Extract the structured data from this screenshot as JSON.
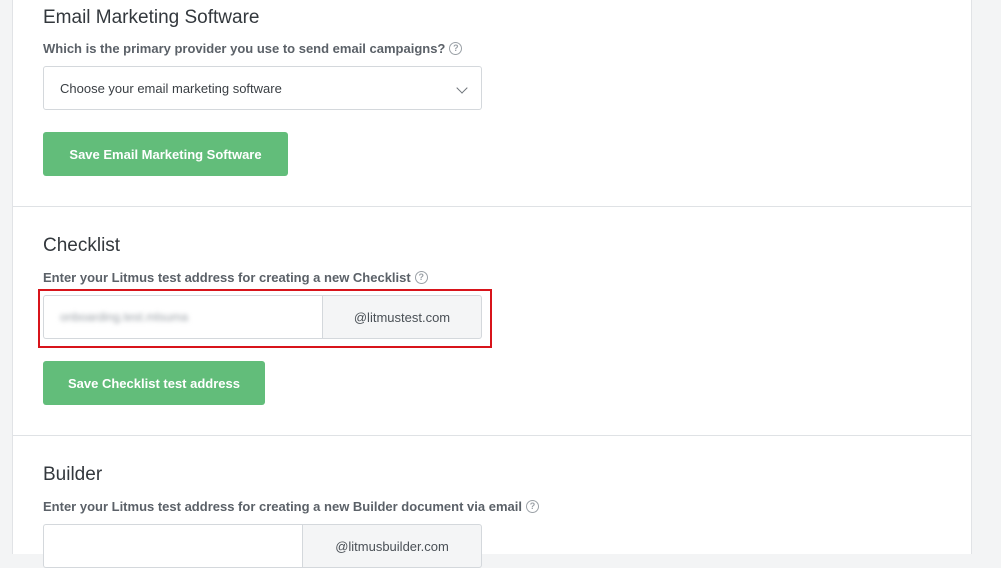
{
  "email_marketing": {
    "title": "Email Marketing Software",
    "question": "Which is the primary provider you use to send email campaigns?",
    "select_value": "Choose your email marketing software",
    "save_label": "Save Email Marketing Software"
  },
  "checklist": {
    "title": "Checklist",
    "question": "Enter your Litmus test address for creating a new Checklist",
    "address_value": "onboarding.test.mlsuma",
    "domain_suffix": "@litmustest.com",
    "save_label": "Save Checklist test address"
  },
  "builder": {
    "title": "Builder",
    "question": "Enter your Litmus test address for creating a new Builder document via email",
    "address_value": "",
    "domain_suffix": "@litmusbuilder.com"
  },
  "help_icon_glyph": "?",
  "colors": {
    "button_green": "#62bd7a",
    "highlight_red": "#d8141b"
  }
}
